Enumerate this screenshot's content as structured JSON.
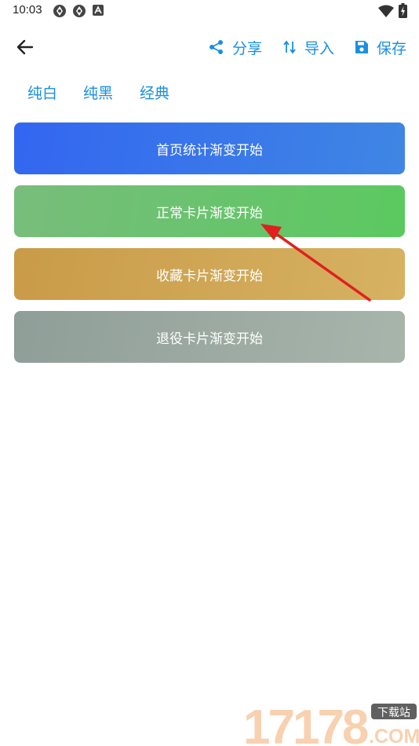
{
  "status_bar": {
    "time": "10:03"
  },
  "toolbar": {
    "back_icon": "arrow-left-icon",
    "actions": [
      {
        "label": "分享",
        "icon": "share-icon"
      },
      {
        "label": "导入",
        "icon": "swap-vert-icon"
      },
      {
        "label": "保存",
        "icon": "save-icon"
      }
    ]
  },
  "tabs": [
    "纯白",
    "纯黑",
    "经典"
  ],
  "buttons": [
    {
      "label": "首页统计渐变开始"
    },
    {
      "label": "正常卡片渐变开始"
    },
    {
      "label": "收藏卡片渐变开始"
    },
    {
      "label": "退役卡片渐变开始"
    }
  ],
  "watermark": {
    "number": "17178",
    "caption": "下载站",
    "domain": ".COM"
  },
  "colors": {
    "accent": "#1a8fe0",
    "home_gradient": [
      "#3366f0",
      "#3f86e4"
    ],
    "normal_gradient": [
      "#78bd7c",
      "#5bc95f"
    ],
    "favorite_gradient": [
      "#c99b48",
      "#d6b262"
    ],
    "retired_gradient": [
      "#8f9e98",
      "#a8b5ab"
    ],
    "annotation_arrow": "#e02020"
  }
}
